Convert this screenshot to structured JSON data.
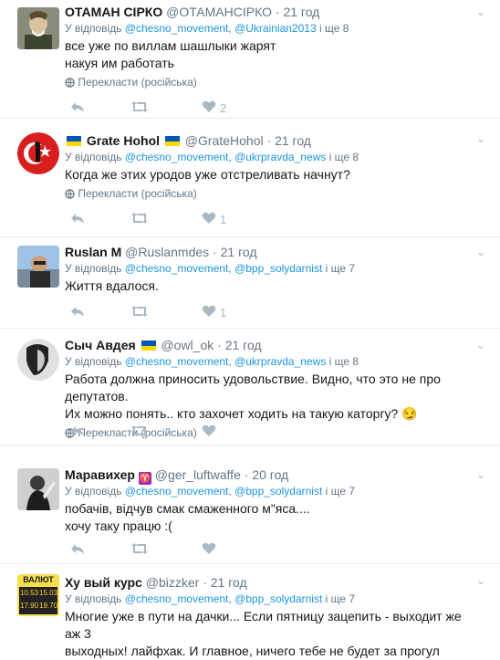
{
  "tweets": [
    {
      "name": "ОТАМАН СІРКО",
      "handle": "@ОТАМАНСІРКО",
      "time": "21 год",
      "reply_prefix": "У відповідь",
      "reply_users": [
        "@chesno_movement",
        "@Ukrainian2013"
      ],
      "reply_more": "і ще 8",
      "lines": [
        "все уже по виллам шашлыки жарят",
        "накуя им работать"
      ],
      "translate": "Перекласти (російська)",
      "likes": "2"
    },
    {
      "name": "Grate Hohol",
      "handle": "@GrateHohol",
      "time": "21 год",
      "reply_prefix": "У відповідь",
      "reply_users": [
        "@chesno_movement",
        "@ukrpravda_news"
      ],
      "reply_more": "і ще 8",
      "lines": [
        "Когда же этих уродов уже отстреливать начнут?"
      ],
      "translate": "Перекласти (російська)",
      "likes": "1"
    },
    {
      "name": "Ruslan M",
      "handle": "@Ruslanmdes",
      "time": "21 год",
      "reply_prefix": "У відповідь",
      "reply_users": [
        "@chesno_movement",
        "@bpp_solydarnist"
      ],
      "reply_more": "і ще 7",
      "lines": [
        "Життя вдалося."
      ],
      "translate": "",
      "likes": "1"
    },
    {
      "name": "Сыч Авдея",
      "handle": "@owl_ok",
      "time": "21 год",
      "reply_prefix": "У відповідь",
      "reply_users": [
        "@chesno_movement",
        "@ukrpravda_news"
      ],
      "reply_more": "і ще 8",
      "lines": [
        "Работа должна приносить удовольствие. Видно, что это не про депутатов.",
        "Их можно понять.. кто захочет ходить на такую каторгу? 😏"
      ],
      "translate": "Перекласти (російська)",
      "likes": ""
    },
    {
      "name": "Маравихер",
      "handle": "@ger_luftwaffe",
      "time": "20 год",
      "reply_prefix": "У відповідь",
      "reply_users": [
        "@chesno_movement",
        "@bpp_solydarnist"
      ],
      "reply_more": "і ще 7",
      "lines": [
        "побачів, відчув смак смаженного м\"яса....",
        "хочу таку працю :("
      ],
      "translate": "",
      "likes": ""
    },
    {
      "name": "Ху  вый курс",
      "handle": "@bizzker",
      "time": "21 год",
      "reply_prefix": "У відповідь",
      "reply_users": [
        "@chesno_movement",
        "@bpp_solydarnist"
      ],
      "reply_more": "і ще 7",
      "lines": [
        "Многие уже в пути на дачки... Если пятницу зацепить - выходит же аж 3",
        "выходных! лайфхак. И главное, ничего тебе не будет за прогул"
      ],
      "translate": "",
      "likes": ""
    }
  ],
  "avatar6_text": [
    "ВАЛЮТ",
    "10.53",
    "15.03",
    "17.90",
    "19.70"
  ],
  "colors": {
    "link": "#1b95e0",
    "muted": "#657786",
    "action": "#aab8c2",
    "flag_blue": "#0057b7",
    "flag_yellow": "#ffd700",
    "badge": "#8a2be2"
  },
  "icons": [
    "reply-icon",
    "retweet-icon",
    "like-icon",
    "caret-down-icon",
    "globe-icon"
  ]
}
